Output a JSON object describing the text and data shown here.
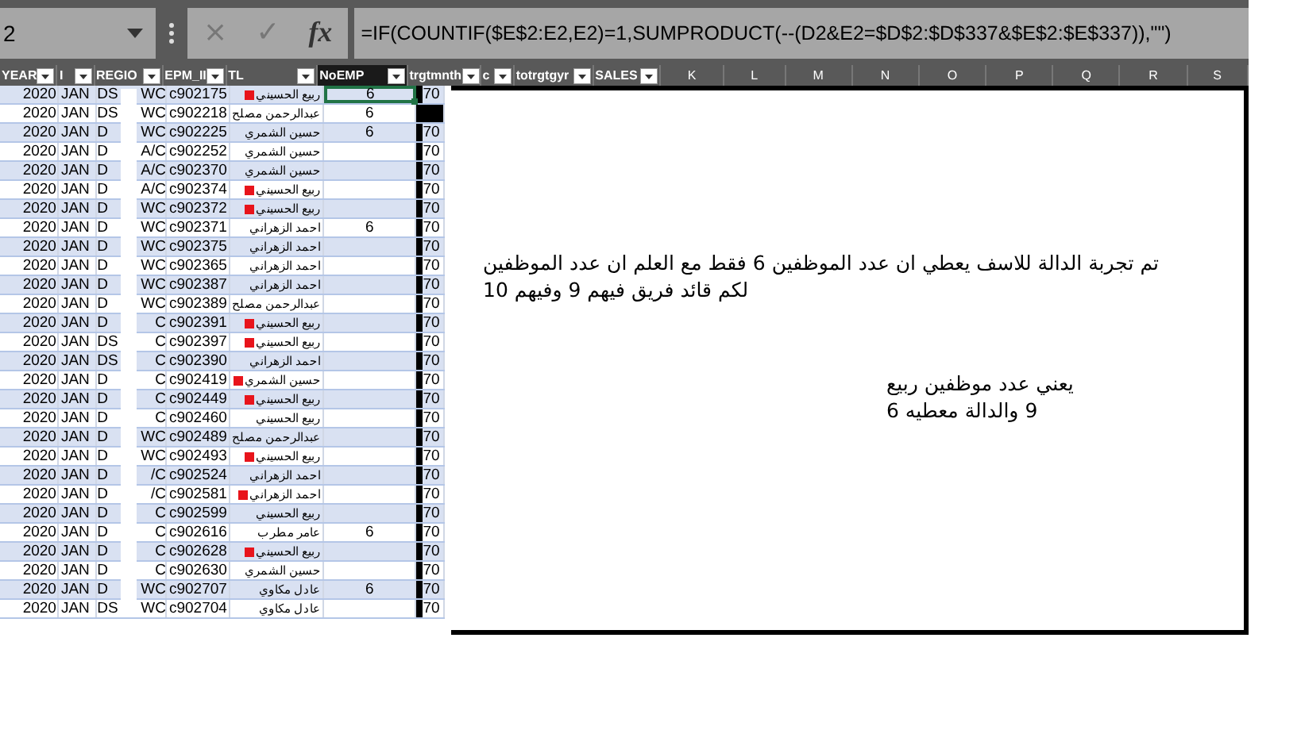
{
  "formula_bar": {
    "name_box": "2",
    "cancel": "×",
    "confirm": "✓",
    "fx": "fx",
    "formula": "=IF(COUNTIF($E$2:E2,E2)=1,SUMPRODUCT(--(D2&E2=$D$2:$D$337&$E$2:$E$337)),\"\")"
  },
  "columns": [
    {
      "label": "YEAR",
      "filter": true,
      "dark": false
    },
    {
      "label": "I",
      "filter": true,
      "dark": false
    },
    {
      "label": "REGIO",
      "filter": true,
      "dark": false
    },
    {
      "label": "EPM_II",
      "filter": true,
      "dark": false
    },
    {
      "label": "TL",
      "filter": true,
      "dark": false
    },
    {
      "label": "NoEMP",
      "filter": true,
      "dark": true
    },
    {
      "label": "trgtmnth",
      "filter": true,
      "dark": false
    },
    {
      "label": "c",
      "filter": true,
      "dark": false
    },
    {
      "label": "totrgtgyr",
      "filter": true,
      "dark": false
    },
    {
      "label": "SALES",
      "filter": true,
      "dark": false
    },
    {
      "label": "K",
      "filter": false,
      "dark": false
    },
    {
      "label": "L",
      "filter": false,
      "dark": false
    },
    {
      "label": "M",
      "filter": false,
      "dark": false
    },
    {
      "label": "N",
      "filter": false,
      "dark": false
    },
    {
      "label": "O",
      "filter": false,
      "dark": false
    },
    {
      "label": "P",
      "filter": false,
      "dark": false
    },
    {
      "label": "Q",
      "filter": false,
      "dark": false
    },
    {
      "label": "R",
      "filter": false,
      "dark": false
    },
    {
      "label": "S",
      "filter": false,
      "dark": false
    }
  ],
  "rows": [
    {
      "year": "2020",
      "month": "JAN",
      "region_start": "DS",
      "region_end": "WC",
      "epm_id": "c902175",
      "tl": "ربيع الحسيني",
      "flag": true,
      "noemp": "6",
      "selected": true,
      "trgtmnth": "70"
    },
    {
      "year": "2020",
      "month": "JAN",
      "region_start": "DS",
      "region_end": "WC",
      "epm_id": "c902218",
      "tl": "عبدالرحمن مصلح",
      "flag": false,
      "noemp": "6",
      "selected": false
    },
    {
      "year": "2020",
      "month": "JAN",
      "region_start": "D",
      "region_end": "WC",
      "epm_id": "c902225",
      "tl": "حسين الشمري",
      "flag": false,
      "noemp": "6",
      "selected": false,
      "trgtmnth": "70"
    },
    {
      "year": "2020",
      "month": "JAN",
      "region_start": "D",
      "region_end": "A/C",
      "epm_id": "c902252",
      "tl": "حسين الشمري",
      "flag": false,
      "selected": false,
      "trgtmnth": "70"
    },
    {
      "year": "2020",
      "month": "JAN",
      "region_start": "D",
      "region_end": "A/C",
      "epm_id": "c902370",
      "tl": "حسين الشمري",
      "flag": false,
      "selected": false,
      "trgtmnth": "70"
    },
    {
      "year": "2020",
      "month": "JAN",
      "region_start": "D",
      "region_end": "A/C",
      "epm_id": "c902374",
      "tl": "ربيع الحسيني",
      "flag": true,
      "selected": false,
      "trgtmnth": "70"
    },
    {
      "year": "2020",
      "month": "JAN",
      "region_start": "D",
      "region_end": "WC",
      "epm_id": "c902372",
      "tl": "ربيع الحسيني",
      "flag": true,
      "selected": false,
      "trgtmnth": "70"
    },
    {
      "year": "2020",
      "month": "JAN",
      "region_start": "D",
      "region_end": "WC",
      "epm_id": "c902371",
      "tl": "احمد الزهراني",
      "flag": false,
      "noemp": "6",
      "selected": false,
      "trgtmnth": "70"
    },
    {
      "year": "2020",
      "month": "JAN",
      "region_start": "D",
      "region_end": "WC",
      "epm_id": "c902375",
      "tl": "احمد الزهراني",
      "flag": false,
      "selected": false,
      "trgtmnth": "70"
    },
    {
      "year": "2020",
      "month": "JAN",
      "region_start": "D",
      "region_end": "WC",
      "epm_id": "c902365",
      "tl": "احمد الزهراني",
      "flag": false,
      "selected": false,
      "trgtmnth": "70"
    },
    {
      "year": "2020",
      "month": "JAN",
      "region_start": "D",
      "region_end": "WC",
      "epm_id": "c902387",
      "tl": "احمد الزهراني",
      "flag": false,
      "selected": false,
      "trgtmnth": "70"
    },
    {
      "year": "2020",
      "month": "JAN",
      "region_start": "D",
      "region_end": "WC",
      "epm_id": "c902389",
      "tl": "عبدالرحمن مصلح",
      "flag": false,
      "selected": false,
      "trgtmnth": "70"
    },
    {
      "year": "2020",
      "month": "JAN",
      "region_start": "D",
      "region_end": "C",
      "epm_id": "c902391",
      "tl": "ربيع الحسيني",
      "flag": true,
      "selected": false,
      "trgtmnth": "70"
    },
    {
      "year": "2020",
      "month": "JAN",
      "region_start": "DS",
      "region_end": "C",
      "epm_id": "c902397",
      "tl": "ربيع الحسيني",
      "flag": true,
      "selected": false,
      "trgtmnth": "70"
    },
    {
      "year": "2020",
      "month": "JAN",
      "region_start": "DS",
      "region_end": "C",
      "epm_id": "c902390",
      "tl": "احمد الزهراني",
      "flag": false,
      "selected": false,
      "trgtmnth": "70"
    },
    {
      "year": "2020",
      "month": "JAN",
      "region_start": "D",
      "region_end": "C",
      "epm_id": "c902419",
      "tl": "حسين الشمري",
      "flag": true,
      "selected": false,
      "trgtmnth": "70"
    },
    {
      "year": "2020",
      "month": "JAN",
      "region_start": "D",
      "region_end": "C",
      "epm_id": "c902449",
      "tl": "ربيع الحسيني",
      "flag": true,
      "selected": false,
      "trgtmnth": "70"
    },
    {
      "year": "2020",
      "month": "JAN",
      "region_start": "D",
      "region_end": "C",
      "epm_id": "c902460",
      "tl": "ربيع الحسيني",
      "flag": false,
      "selected": false,
      "trgtmnth": "70"
    },
    {
      "year": "2020",
      "month": "JAN",
      "region_start": "D",
      "region_end": "WC",
      "epm_id": "c902489",
      "tl": "عبدالرحمن مصلح",
      "flag": false,
      "selected": false,
      "trgtmnth": "70"
    },
    {
      "year": "2020",
      "month": "JAN",
      "region_start": "D",
      "region_end": "WC",
      "epm_id": "c902493",
      "tl": "ربيع الحسيني",
      "flag": true,
      "selected": false,
      "trgtmnth": "70"
    },
    {
      "year": "2020",
      "month": "JAN",
      "region_start": "D",
      "region_end": "/C",
      "epm_id": "c902524",
      "tl": "احمد الزهراني",
      "flag": false,
      "selected": false,
      "trgtmnth": "70"
    },
    {
      "year": "2020",
      "month": "JAN",
      "region_start": "D",
      "region_end": "/C",
      "epm_id": "c902581",
      "tl": "احمد الزهراني",
      "flag": true,
      "selected": false,
      "trgtmnth": "70"
    },
    {
      "year": "2020",
      "month": "JAN",
      "region_start": "D",
      "region_end": "C",
      "epm_id": "c902599",
      "tl": "ربيع الحسيني",
      "flag": false,
      "selected": false,
      "trgtmnth": "70"
    },
    {
      "year": "2020",
      "month": "JAN",
      "region_start": "D",
      "region_end": "C",
      "epm_id": "c902616",
      "tl": "عامر مطرب",
      "flag": false,
      "noemp": "6",
      "selected": false,
      "trgtmnth": "70"
    },
    {
      "year": "2020",
      "month": "JAN",
      "region_start": "D",
      "region_end": "C",
      "epm_id": "c902628",
      "tl": "ربيع الحسيني",
      "flag": true,
      "selected": false,
      "trgtmnth": "70"
    },
    {
      "year": "2020",
      "month": "JAN",
      "region_start": "D",
      "region_end": "C",
      "epm_id": "c902630",
      "tl": "حسين الشمري",
      "flag": false,
      "selected": false,
      "trgtmnth": "70"
    },
    {
      "year": "2020",
      "month": "JAN",
      "region_start": "D",
      "region_end": "WC",
      "epm_id": "c902707",
      "tl": "عادل مكاوي",
      "flag": false,
      "noemp": "6",
      "selected": false,
      "trgtmnth": "70"
    },
    {
      "year": "2020",
      "month": "JAN",
      "region_start": "DS",
      "region_end": "WC",
      "epm_id": "c902704",
      "tl": "عادل مكاوي",
      "flag": false,
      "selected": false,
      "trgtmnth": "70"
    }
  ],
  "note": {
    "paragraph_1": [
      "تم تجربة الدالة للاسف يعطي ان عدد الموظفين 6 فقط مع العلم ان عدد الموظفين",
      "لكم قائد فريق فيهم 9 وفيهم 10"
    ],
    "paragraph_2": [
      "يعني عدد موظفين ربيع",
      "9 والدالة معطيه 6"
    ]
  }
}
